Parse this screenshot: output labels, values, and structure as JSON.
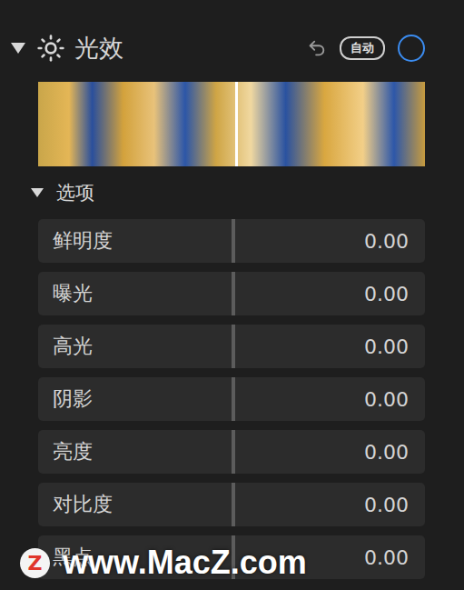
{
  "panel": {
    "title": "光效",
    "expanded": true,
    "auto_button": "自动",
    "toggle_on": false
  },
  "photo_strip": {
    "divider_level": 0.51
  },
  "options": {
    "title": "选项",
    "expanded": true
  },
  "sliders": [
    {
      "label": "鲜明度",
      "value": "0.00",
      "level": 0.5
    },
    {
      "label": "曝光",
      "value": "0.00",
      "level": 0.5
    },
    {
      "label": "高光",
      "value": "0.00",
      "level": 0.5
    },
    {
      "label": "阴影",
      "value": "0.00",
      "level": 0.5
    },
    {
      "label": "亮度",
      "value": "0.00",
      "level": 0.5
    },
    {
      "label": "对比度",
      "value": "0.00",
      "level": 0.5
    },
    {
      "label": "黑点",
      "value": "0.00",
      "level": 0.5
    }
  ],
  "watermark": {
    "logo": "Z",
    "text": "www.MacZ.com"
  }
}
